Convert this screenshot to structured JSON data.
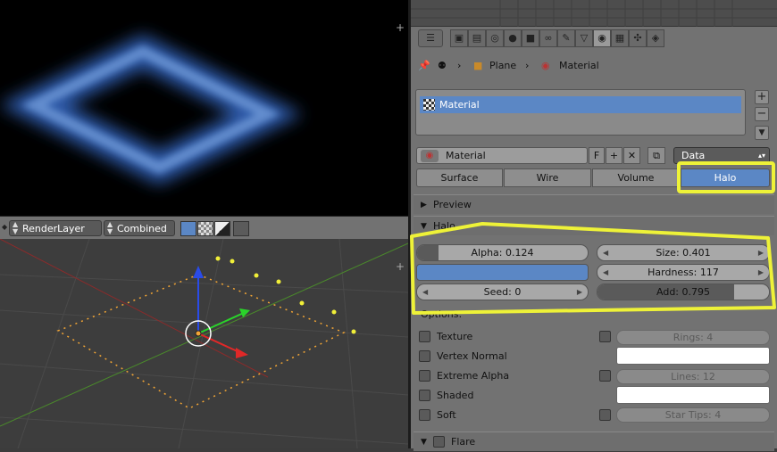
{
  "viewport_header": {
    "render_layer": "RenderLayer",
    "pass": "Combined"
  },
  "breadcrumb": {
    "object": "Plane",
    "material": "Material"
  },
  "material_slots": [
    "Material"
  ],
  "material_selector": {
    "name": "Material",
    "fake_user": "F",
    "link": "Data"
  },
  "material_types": [
    "Surface",
    "Wire",
    "Volume",
    "Halo"
  ],
  "active_type": "Halo",
  "panels": {
    "preview": "Preview",
    "halo": "Halo",
    "flare": "Flare"
  },
  "halo": {
    "alpha": "Alpha: 0.124",
    "size": "Size: 0.401",
    "hardness": "Hardness: 117",
    "seed": "Seed: 0",
    "add": "Add: 0.795",
    "add_value": 0.795,
    "color": "#5b87c5"
  },
  "options": {
    "heading": "Options:",
    "texture": "Texture",
    "vertex_normal": "Vertex Normal",
    "extreme_alpha": "Extreme Alpha",
    "shaded": "Shaded",
    "soft": "Soft",
    "rings": "Rings: 4",
    "lines": "Lines: 12",
    "star_tips": "Star Tips: 4"
  },
  "colors": {
    "accent": "#5b87c5",
    "highlight": "#eef238"
  }
}
